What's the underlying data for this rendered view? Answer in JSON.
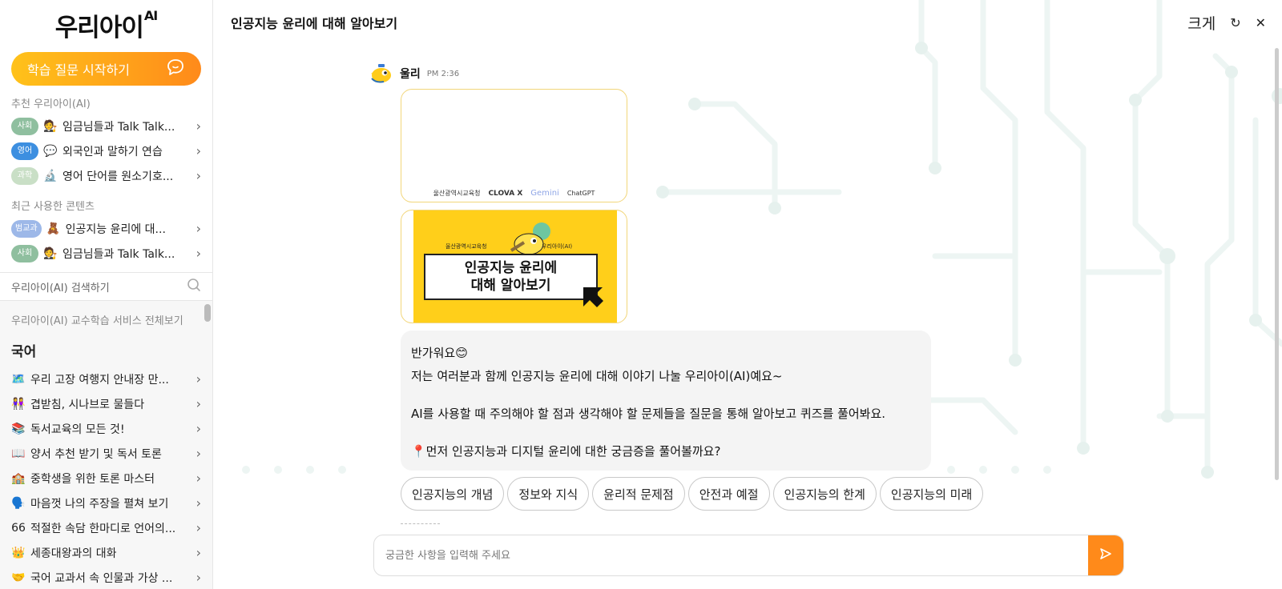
{
  "sidebar": {
    "logo_text": "우리아이",
    "logo_sup": "AI",
    "start_button_label": "학습 질문 시작하기",
    "recommended_label": "추천 우리아이(AI)",
    "recommended": [
      {
        "tag": "사회",
        "tag_color": "#8fbf9f",
        "emoji": "🧑‍⚖️",
        "label": "임금님들과 Talk Talk..."
      },
      {
        "tag": "영어",
        "tag_color": "#3d8fe0",
        "emoji": "💬",
        "label": "외국인과 말하기 연습"
      },
      {
        "tag": "과학",
        "tag_color": "#c9dfc6",
        "emoji": "🔬",
        "label": "영어 단어를 원소기호..."
      }
    ],
    "recent_label": "최근 사용한 콘텐츠",
    "recent": [
      {
        "tag": "범교과",
        "tag_color": "#9db8e8",
        "emoji": "🧸",
        "label": "인공지능 윤리에 대..."
      },
      {
        "tag": "사회",
        "tag_color": "#8fbf9f",
        "emoji": "🧑‍⚖️",
        "label": "임금님들과 Talk Talk..."
      }
    ],
    "search_placeholder": "우리아이(AI) 검색하기",
    "all_services_label": "우리아이(AI) 교수학습 서비스 전체보기",
    "subject_title": "국어",
    "subject_items": [
      {
        "emoji": "🗺️",
        "label": "우리 고장 여행지 안내장 만..."
      },
      {
        "emoji": "👭",
        "label": "겹받침, 시나브로 물들다"
      },
      {
        "emoji": "📚",
        "label": "독서교육의 모든 것!"
      },
      {
        "emoji": "📖",
        "label": "양서 추천 받기 및 독서 토론"
      },
      {
        "emoji": "🏫",
        "label": "중학생을 위한 토론 마스터"
      },
      {
        "emoji": "🗣️",
        "label": "마음껏 나의 주장을 펼쳐 보기"
      },
      {
        "emoji": "66",
        "label": "적절한 속담 한마디로 언어의..."
      },
      {
        "emoji": "👑",
        "label": "세종대왕과의 대화"
      },
      {
        "emoji": "🤝",
        "label": "국어 교과서 속 인물과 가상 ..."
      }
    ]
  },
  "header": {
    "title": "인공지능 윤리에 대해 알아보기",
    "font_size_label": "크게",
    "refresh_icon": "↻",
    "close_icon": "✕"
  },
  "chat": {
    "bot_name": "울리",
    "time": "PM 2:36",
    "card1_logos": [
      "울산광역시교육청",
      "CLOVA X",
      "Gemini",
      "ChatGPT"
    ],
    "poster": {
      "org": "울산광역시교육청",
      "brand": "우리아이(AI)",
      "line1": "인공지능 윤리에",
      "line2": "대해 알아보기"
    },
    "greeting": "반가워요😊",
    "line2": "저는 여러분과 함께 인공지능 윤리에 대해 이야기 나눌 우리아이(AI)예요~",
    "line3": "AI를 사용할 때 주의해야 할 점과 생각해야 할 문제들을 질문을 통해 알아보고 퀴즈를 풀어봐요.",
    "line4": "📍먼저 인공지능과 디지털 윤리에 대한 궁금증을 풀어볼까요?",
    "chips": [
      "인공지능의 개념",
      "정보와 지식",
      "윤리적 문제점",
      "안전과 예절",
      "인공지능의 한계",
      "인공지능의 미래"
    ]
  },
  "input": {
    "placeholder": "궁금한 사항을 입력해 주세요"
  },
  "colors": {
    "accent": "#ff8a1a",
    "accent_start": "#ffc21a",
    "poster_yellow": "#ffcf1a",
    "circuit": "#edf5f3"
  }
}
